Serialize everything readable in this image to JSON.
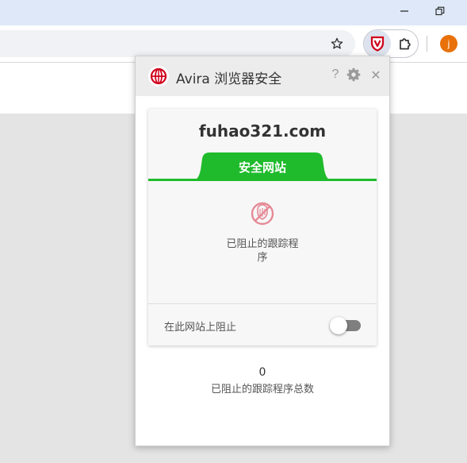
{
  "browser": {
    "colors": {
      "titlebar": "#dee8f8",
      "toolbar": "#ffffff",
      "omnibox": "#f0f2f5"
    },
    "window_controls": [
      "minimize-icon",
      "restore-icon"
    ],
    "toolbar_icons": [
      "star-icon",
      "avira-shield-icon",
      "puzzle-extensions-icon"
    ],
    "profile": {
      "initial": "j",
      "color": "#e8710a"
    }
  },
  "popup": {
    "title": "Avira 浏览器安全",
    "header_icons": [
      "help-icon",
      "gear-icon",
      "close-icon"
    ],
    "help_label": "?",
    "close_label": "✕",
    "domain": "fuhao321.com",
    "status": {
      "label": "安全网站",
      "color": "#1fbb2c"
    },
    "tracker_icon": "blocked-tracker-icon",
    "blocked_label_line1": "已阻止的跟踪程",
    "blocked_label_line2": "序",
    "block_on_site_label": "在此网站上阻止",
    "block_toggle_on": false,
    "total_blocked_count": "0",
    "total_blocked_label": "已阻止的跟踪程序总数"
  }
}
